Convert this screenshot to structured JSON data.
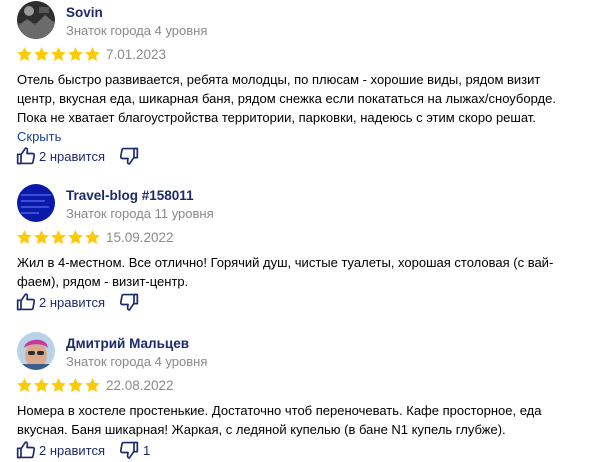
{
  "reviews": [
    {
      "author": "Sovin",
      "level": "Знаток города 4 уровня",
      "rating": 5,
      "date": "7.01.2023",
      "text": "Отель быстро развивается, ребята молодцы, по плюсам - хорошие виды, рядом визит центр, вкусная еда, шикарная баня, рядом снежка если покататься на лыжах/сноуборде. Пока не хватает благоустройства территории, парковки, надеюсь с этим скоро решат.",
      "toggle_label": "Скрыть",
      "likes_label": "2 нравится",
      "dislikes": ""
    },
    {
      "author": "Travel-blog #158011",
      "level": "Знаток города 11 уровня",
      "rating": 5,
      "date": "15.09.2022",
      "text": "Жил в 4-местном. Все отлично! Горячий душ, чистые туалеты, хорошая столовая (с вай-фаем), рядом - визит-центр.",
      "toggle_label": "",
      "likes_label": "2 нравится",
      "dislikes": ""
    },
    {
      "author": "Дмитрий Мальцев",
      "level": "Знаток города 4 уровня",
      "rating": 5,
      "date": "22.08.2022",
      "text": "Номера в хостеле простенькие. Достаточно чтоб переночевать. Кафе просторное, еда вкусная. Баня шикарная! Жаркая, с ледяной купелью (в бане N1 купель глубже).",
      "toggle_label": "",
      "likes_label": "2 нравится",
      "dislikes": "1"
    }
  ],
  "colors": {
    "star": "#fccb05",
    "link": "#1a3e99",
    "muted": "#8a8a8a",
    "name": "#1a2a6c"
  },
  "icons": [
    "thumb-up-icon",
    "thumb-down-icon",
    "star-icon"
  ]
}
